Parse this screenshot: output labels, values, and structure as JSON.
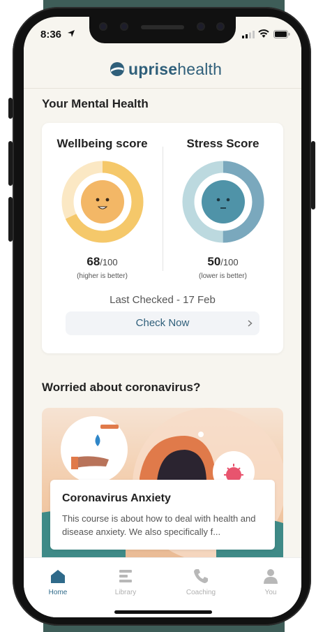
{
  "status_bar": {
    "time": "8:36"
  },
  "header": {
    "logo_bold": "uprise",
    "logo_light": "health"
  },
  "mental_health": {
    "section_title": "Your Mental Health",
    "wellbeing": {
      "title": "Wellbeing score",
      "value": "68",
      "denom": "/100",
      "note": "(higher is better)",
      "fraction": 0.68,
      "color": "#f5c86a"
    },
    "stress": {
      "title": "Stress Score",
      "value": "50",
      "denom": "/100",
      "note": "(lower is better)",
      "fraction": 0.5,
      "color": "#7aa8bd"
    },
    "last_checked": "Last Checked - 17 Feb",
    "check_now": "Check Now"
  },
  "coronavirus": {
    "section_title": "Worried about coronavirus?",
    "course_title": "Coronavirus Anxiety",
    "course_desc": "This course is about how to deal with health and disease anxiety. We also specifically f..."
  },
  "tabs": [
    {
      "label": "Home",
      "icon": "home-icon",
      "active": true
    },
    {
      "label": "Library",
      "icon": "library-icon",
      "active": false
    },
    {
      "label": "Coaching",
      "icon": "phone-icon",
      "active": false
    },
    {
      "label": "You",
      "icon": "person-icon",
      "active": false
    }
  ],
  "colors": {
    "brand": "#2f5f7a",
    "accent_active": "#2f6a8a",
    "backdrop": "#3e5d58"
  }
}
